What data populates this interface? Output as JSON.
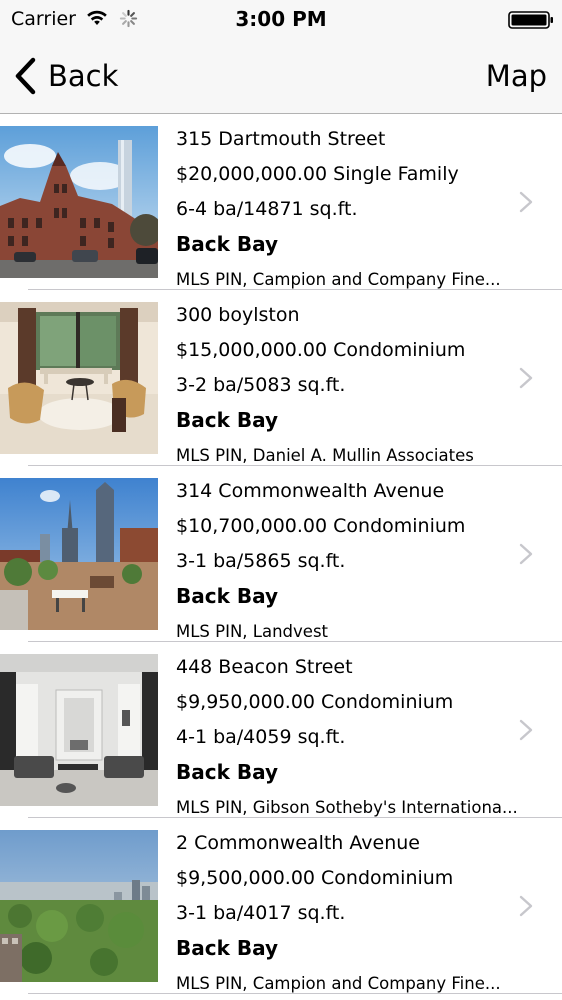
{
  "status_bar": {
    "carrier": "Carrier",
    "time": "3:00 PM",
    "wifi_icon": "wifi-icon",
    "activity_icon": "spinner-icon",
    "battery_icon": "battery-icon"
  },
  "nav": {
    "back_label": "Back",
    "back_icon": "chevron-left-icon",
    "map_label": "Map"
  },
  "listings": [
    {
      "address": "315 Dartmouth Street",
      "price_type": "$20,000,000.00 Single Family",
      "details": "6-4 ba/14871 sq.ft.",
      "neighborhood": "Back Bay",
      "broker": "MLS PIN, Campion and Company Fine..."
    },
    {
      "address": "300 boylston",
      "price_type": "$15,000,000.00 Condominium",
      "details": "3-2 ba/5083 sq.ft.",
      "neighborhood": "Back Bay",
      "broker": "MLS PIN, Daniel A. Mullin Associates"
    },
    {
      "address": "314 Commonwealth Avenue",
      "price_type": "$10,700,000.00 Condominium",
      "details": "3-1 ba/5865 sq.ft.",
      "neighborhood": "Back Bay",
      "broker": "MLS PIN, Landvest"
    },
    {
      "address": "448 Beacon Street",
      "price_type": "$9,950,000.00 Condominium",
      "details": "4-1 ba/4059 sq.ft.",
      "neighborhood": "Back Bay",
      "broker": "MLS PIN, Gibson Sotheby's Internationa..."
    },
    {
      "address": "2 Commonwealth Avenue",
      "price_type": "$9,500,000.00 Condominium",
      "details": "3-1 ba/4017 sq.ft.",
      "neighborhood": "Back Bay",
      "broker": "MLS PIN, Campion and Company Fine..."
    }
  ],
  "colors": {
    "bar_background": "#f7f7f7",
    "separator": "#c8c7cc",
    "disclosure": "#c7c7cc"
  }
}
